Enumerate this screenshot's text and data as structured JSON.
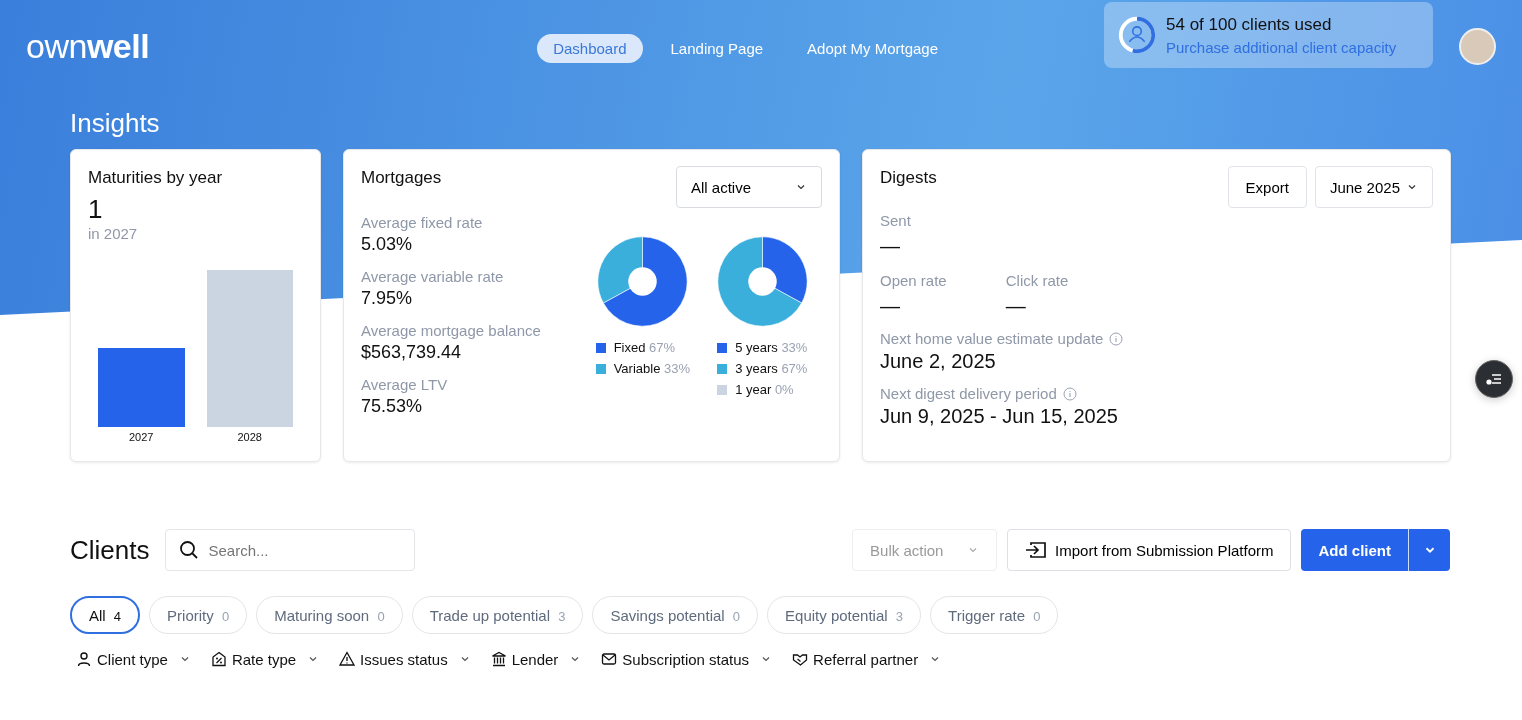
{
  "header": {
    "logo": {
      "light": "own",
      "bold": "well"
    },
    "nav": [
      {
        "label": "Dashboard",
        "selected": true
      },
      {
        "label": "Landing Page",
        "selected": false
      },
      {
        "label": "Adopt My Mortgage",
        "selected": false
      }
    ],
    "capacity": {
      "title": "54 of 100 clients used",
      "link": "Purchase additional client capacity",
      "level": 0.54
    }
  },
  "insights": {
    "title": "Insights",
    "maturities": {
      "title": "Maturities by year",
      "value": "1",
      "caption": "in 2027",
      "categories": [
        "2027",
        "2028"
      ]
    },
    "mortgages": {
      "title": "Mortgages",
      "filter": "All active",
      "stats": [
        {
          "label": "Average fixed rate",
          "value": "5.03%"
        },
        {
          "label": "Average variable rate",
          "value": "7.95%"
        },
        {
          "label": "Average mortgage balance",
          "value": "$563,739.44"
        },
        {
          "label": "Average LTV",
          "value": "75.53%"
        }
      ],
      "charts": [
        {
          "chart_data": {
            "type": "donut",
            "categories": [
              "Fixed",
              "Variable"
            ],
            "series": [
              {
                "values": [
                  67,
                  33
                ]
              }
            ]
          },
          "legend": [
            {
              "share": "67%",
              "color": "#2563eb"
            },
            {
              "share": "33%",
              "color": "#3aafdc"
            }
          ]
        },
        {
          "chart_data": {
            "type": "donut",
            "categories": [
              "5 years",
              "3 years",
              "1 year"
            ],
            "series": [
              {
                "values": [
                  33,
                  67,
                  0
                ]
              }
            ]
          },
          "legend": [
            {
              "share": "33%",
              "color": "#2563eb"
            },
            {
              "share": "67%",
              "color": "#3aafdc"
            },
            {
              "share": "0%",
              "color": "#cbd5e1"
            }
          ]
        }
      ]
    },
    "digests": {
      "title": "Digests",
      "export": "Export",
      "month": "June 2025",
      "sent": {
        "label": "Sent",
        "value": "—"
      },
      "rates": [
        {
          "label": "Open rate",
          "value": "—"
        },
        {
          "label": "Click rate",
          "value": "—"
        }
      ],
      "dates": [
        {
          "label": "Next home value estimate update",
          "value": "June 2, 2025"
        },
        {
          "label": "Next digest delivery period",
          "value": "Jun 9, 2025 - Jun 15, 2025"
        }
      ]
    }
  },
  "clients": {
    "title": "Clients",
    "search": {
      "placeholder": "Search..."
    },
    "bulk_action": "Bulk action",
    "import": "Import from Submission Platform",
    "add": "Add client",
    "tabs": [
      {
        "label": "All",
        "count": "4",
        "selected": true
      },
      {
        "label": "Priority",
        "count": "0",
        "selected": false
      },
      {
        "label": "Maturing soon",
        "count": "0",
        "selected": false
      },
      {
        "label": "Trade up potential",
        "count": "3",
        "selected": false
      },
      {
        "label": "Savings potential",
        "count": "0",
        "selected": false
      },
      {
        "label": "Equity potential",
        "count": "3",
        "selected": false
      },
      {
        "label": "Trigger rate",
        "count": "0",
        "selected": false
      }
    ],
    "filters": [
      {
        "label": "Client type",
        "kind": "person"
      },
      {
        "label": "Rate type",
        "kind": "rate"
      },
      {
        "label": "Issues status",
        "kind": "warning"
      },
      {
        "label": "Lender",
        "kind": "bank"
      },
      {
        "label": "Subscription status",
        "kind": "mail"
      },
      {
        "label": "Referral partner",
        "kind": "handshake"
      }
    ]
  }
}
